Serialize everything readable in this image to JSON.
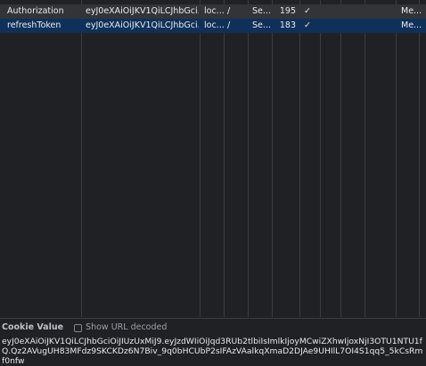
{
  "cookies": [
    {
      "name": "Authorization",
      "value": "eyJ0eXAiOiJKV1QiLCJhbGci...",
      "domain": "loc...",
      "path": "/",
      "expires": "Se...",
      "size": "195",
      "httponly": "✓",
      "samesite": "",
      "partition": "Me..."
    },
    {
      "name": "refreshToken",
      "value": "eyJ0eXAiOiJKV1QiLCJhbGci...",
      "domain": "loc...",
      "path": "/",
      "expires": "Se...",
      "size": "183",
      "httponly": "✓",
      "samesite": "",
      "partition": "Me..."
    }
  ],
  "footer": {
    "label": "Cookie Value",
    "checkbox_label": "Show URL decoded",
    "checkbox_checked": false,
    "value": "eyJ0eXAiOiJKV1QiLCJhbGciOiJIUzUxMiJ9.eyJzdWIiOiJqd3RUb2tlbiIsImlkIjoyMCwiZXhwIjoxNjI3OTU1NTU1fQ.Qz2AVugUH83MFdz9SKCKDz6N7Biv_9q0bHCUbP2sIFAzVAalkqXmaD2DJAe9UHIlL7OI4S1qq5_5kCsRmf0nfw"
  },
  "colors": {
    "background": "#202124",
    "selected_row": "#0f3159",
    "hover_row": "#333438",
    "grid_line": "#3c3c3c"
  }
}
